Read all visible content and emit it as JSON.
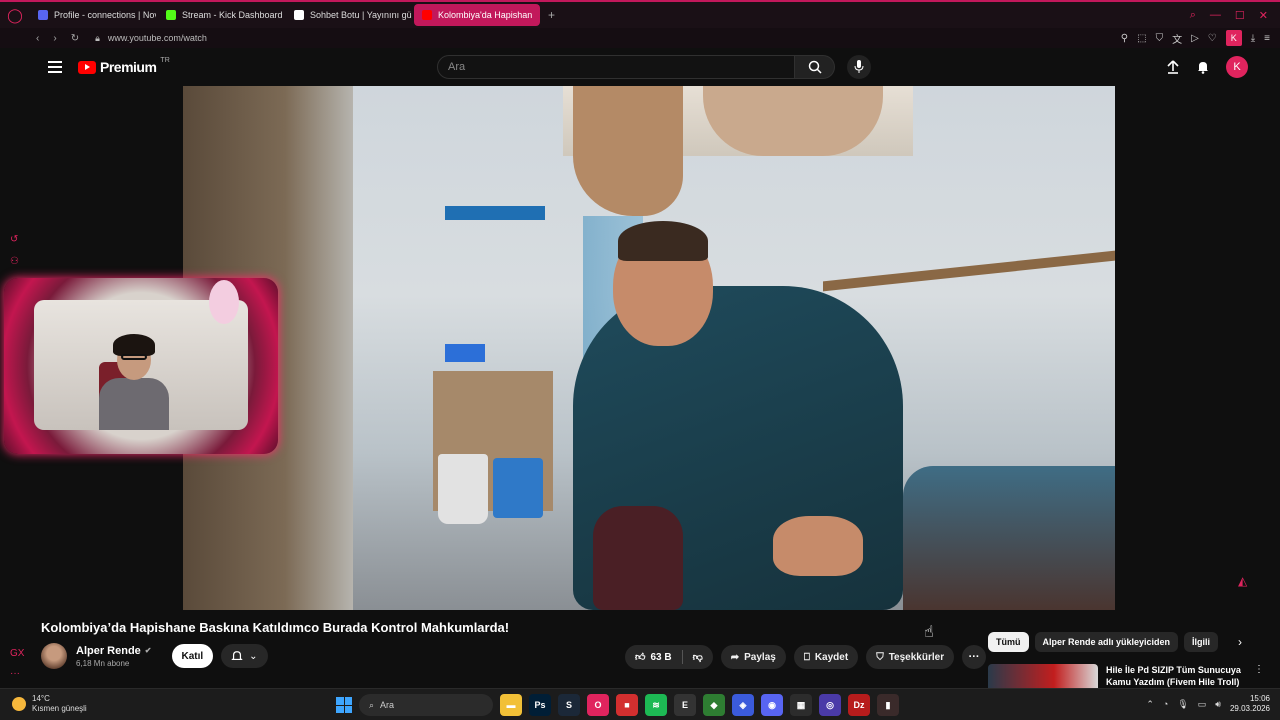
{
  "browser": {
    "tabs": [
      {
        "label": "Profile - connections | Nov",
        "favicon_color": "#5865f2",
        "active": false
      },
      {
        "label": "Stream - Kick Dashboard",
        "favicon_color": "#53fc18",
        "active": false
      },
      {
        "label": "Sohbet Botu | Yayınını güç",
        "favicon_color": "#ffffff",
        "active": false
      },
      {
        "label": "Kolombiya'da Hapishan",
        "favicon_color": "#ff0000",
        "active": true
      }
    ],
    "url": "www.youtube.com/watch",
    "extension_k": "K"
  },
  "youtube": {
    "brand": "Premium",
    "region": "TR",
    "search_placeholder": "Ara",
    "avatar_letter": "K",
    "video": {
      "title": "Kolombiya’da Hapishane Baskına Katıldımco Burada Kontrol Mahkumlarda!",
      "channel_name": "Alper Rende",
      "subscribers": "6,18 Mn abone",
      "join_label": "Katıl",
      "likes": "63 B",
      "share_label": "Paylaş",
      "save_label": "Kaydet",
      "thanks_label": "Teşekkürler",
      "more_label": "···"
    },
    "chips": [
      "Tümü",
      "Alper Rende adlı yükleyiciden",
      "İlgili"
    ],
    "recommendation": {
      "title": "Hile İle Pd SIZIP Tüm Sunucuya Kamu Yazdım (Fivem Hile Troll)"
    }
  },
  "taskbar": {
    "weather_temp": "14°C",
    "weather_desc": "Kısmen güneşli",
    "search_placeholder": "Ara",
    "time": "15:06",
    "date": "29.03.2026",
    "apps": [
      {
        "name": "file-explorer",
        "color": "#f2c037",
        "glyph": "▬"
      },
      {
        "name": "photoshop",
        "color": "#001e36",
        "glyph": "Ps"
      },
      {
        "name": "steam",
        "color": "#1b2838",
        "glyph": "S"
      },
      {
        "name": "opera-gx",
        "color": "#e0245e",
        "glyph": "O"
      },
      {
        "name": "app-red",
        "color": "#d32f2f",
        "glyph": "■"
      },
      {
        "name": "spotify",
        "color": "#1db954",
        "glyph": "≋"
      },
      {
        "name": "epic-games",
        "color": "#333333",
        "glyph": "E"
      },
      {
        "name": "app-green",
        "color": "#2e7d32",
        "glyph": "◆"
      },
      {
        "name": "app-blue",
        "color": "#3b5bdb",
        "glyph": "◈"
      },
      {
        "name": "discord",
        "color": "#5865f2",
        "glyph": "◉"
      },
      {
        "name": "app-grid",
        "color": "#2c2c2c",
        "glyph": "▦"
      },
      {
        "name": "app-purple",
        "color": "#4a3aa8",
        "glyph": "◎"
      },
      {
        "name": "dizi-app",
        "color": "#b71c1c",
        "glyph": "Dz"
      },
      {
        "name": "app-dark",
        "color": "#3a2a2a",
        "glyph": "▮"
      }
    ]
  }
}
